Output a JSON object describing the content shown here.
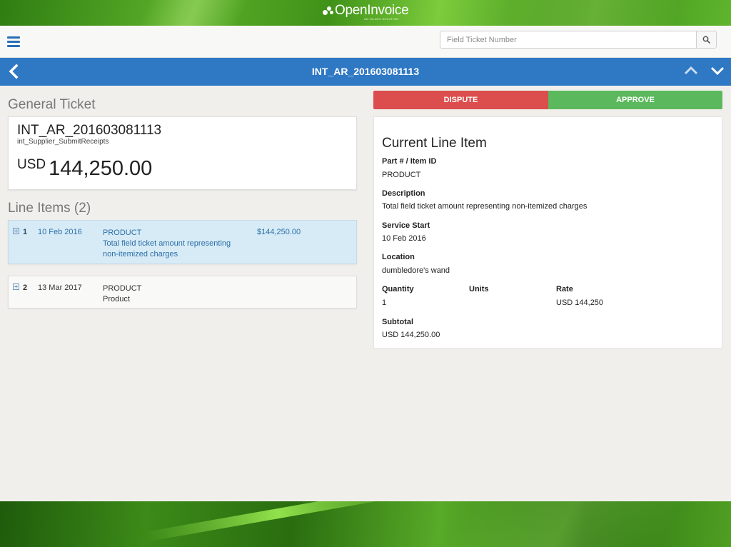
{
  "app": {
    "logo_text": "OpenInvoice",
    "logo_tagline": "AN OILDEX SOLUTION"
  },
  "search": {
    "placeholder": "Field Ticket Number",
    "value": ""
  },
  "titlebar": {
    "title": "INT_AR_201603081113"
  },
  "general": {
    "heading": "General Ticket",
    "ticket_id": "INT_AR_201603081113",
    "supplier": "int_Supplier_SubmitReceipts",
    "currency": "USD",
    "amount": "144,250.00"
  },
  "line_items": {
    "heading": "Line Items (2)",
    "items": [
      {
        "num": "1",
        "date": "10 Feb 2016",
        "part": "PRODUCT",
        "description": "Total field ticket amount representing non-itemized charges",
        "price": "$144,250.00",
        "selected": true
      },
      {
        "num": "2",
        "date": "13 Mar 2017",
        "part": "PRODUCT",
        "description": "Product",
        "price": "",
        "selected": false
      }
    ]
  },
  "actions": {
    "dispute": "DISPUTE",
    "approve": "APPROVE"
  },
  "current_item": {
    "heading": "Current Line Item",
    "part_label": "Part # / Item ID",
    "part_value": "PRODUCT",
    "description_label": "Description",
    "description_value": "Total field ticket amount representing non-itemized charges",
    "service_start_label": "Service Start",
    "service_start_value": "10 Feb 2016",
    "location_label": "Location",
    "location_value": "dumbledore's wand",
    "quantity_label": "Quantity",
    "quantity_value": "1",
    "units_label": "Units",
    "units_value": "",
    "rate_label": "Rate",
    "rate_value": "USD 144,250",
    "subtotal_label": "Subtotal",
    "subtotal_value": "USD 144,250.00"
  },
  "colors": {
    "primary_blue": "#2f78c4",
    "dispute_red": "#dc4d4d",
    "approve_green": "#5bb85c",
    "selected_row": "#d7ebf6"
  }
}
